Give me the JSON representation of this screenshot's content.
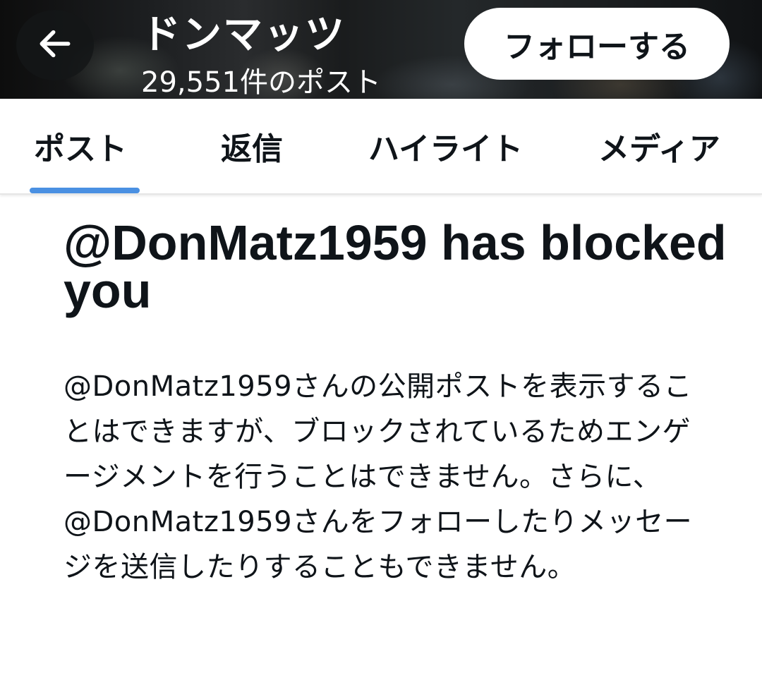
{
  "header": {
    "profile_name": "ドンマッツ",
    "post_count": "29,551件のポスト",
    "follow_label": "フォローする",
    "back_icon": "arrow-left-icon"
  },
  "tabs": [
    {
      "label": "ポスト",
      "selected": true
    },
    {
      "label": "返信",
      "selected": false
    },
    {
      "label": "ハイライト",
      "selected": false
    },
    {
      "label": "メディア",
      "selected": false
    }
  ],
  "main": {
    "title": "@DonMatz1959 has blocked you",
    "description": "@DonMatz1959さんの公開ポストを表示することはできますが、ブロックされているためエンゲージメントを行うことはできません。さらに、@DonMatz1959さんをフォローしたりメッセージを送信したりすることもできません。"
  },
  "colors": {
    "tab_indicator": "#4a90e2",
    "text": "#0f1419"
  }
}
